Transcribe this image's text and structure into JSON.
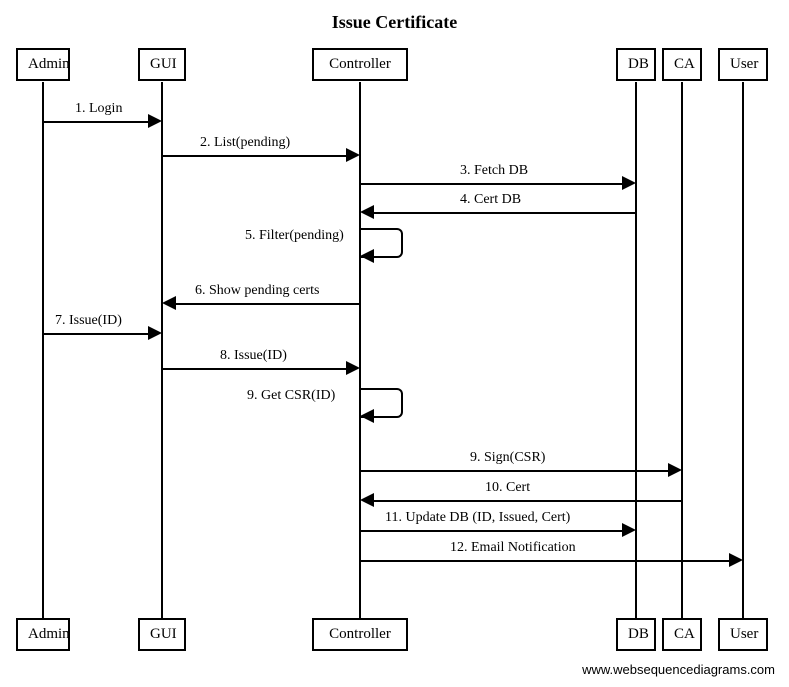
{
  "title": "Issue Certificate",
  "actors": {
    "admin": "Admin",
    "gui": "GUI",
    "controller": "Controller",
    "db": "DB",
    "ca": "CA",
    "user": "User"
  },
  "messages": {
    "m1": "1. Login",
    "m2": "2. List(pending)",
    "m3": "3. Fetch DB",
    "m4": "4. Cert DB",
    "m5": "5. Filter(pending)",
    "m6": "6. Show pending certs",
    "m7": "7. Issue(ID)",
    "m8": "8. Issue(ID)",
    "m9a": "9. Get CSR(ID)",
    "m9b": "9. Sign(CSR)",
    "m10": "10. Cert",
    "m11": "11. Update DB (ID, Issued, Cert)",
    "m12": "12. Email Notification"
  },
  "footer": "www.websequencediagrams.com"
}
